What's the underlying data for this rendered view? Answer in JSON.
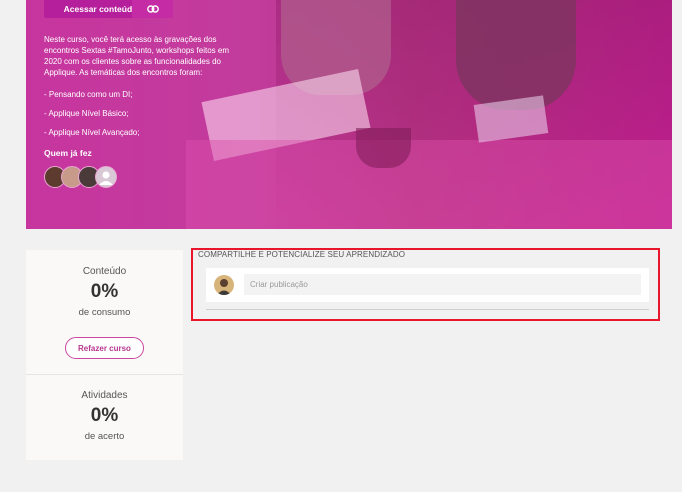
{
  "hero": {
    "access_button": "Acessar conteúdo",
    "link_icon": "link-icon",
    "description": "Neste curso, você terá acesso às gravações dos encontros Sextas #TamoJunto, workshops feitos em 2020 com os clientes sobre as funcionalidades do Applique. As temáticas dos encontros foram:",
    "topics": [
      "- Pensando como um DI;",
      "- Applique Nível Básico;",
      "- Applique Nível Avançado;"
    ],
    "who_did": "Quem já fez"
  },
  "sidebar": {
    "content": {
      "label": "Conteúdo",
      "value": "0%",
      "sub": "de consumo"
    },
    "redo_button": "Refazer curso",
    "activities": {
      "label": "Atividades",
      "value": "0%",
      "sub": "de acerto"
    }
  },
  "share": {
    "title": "COMPARTILHE E POTENCIALIZE SEU APRENDIZADO",
    "placeholder": "Criar publicação"
  },
  "colors": {
    "accent": "#b51f9b",
    "highlight": "#e8152b"
  }
}
